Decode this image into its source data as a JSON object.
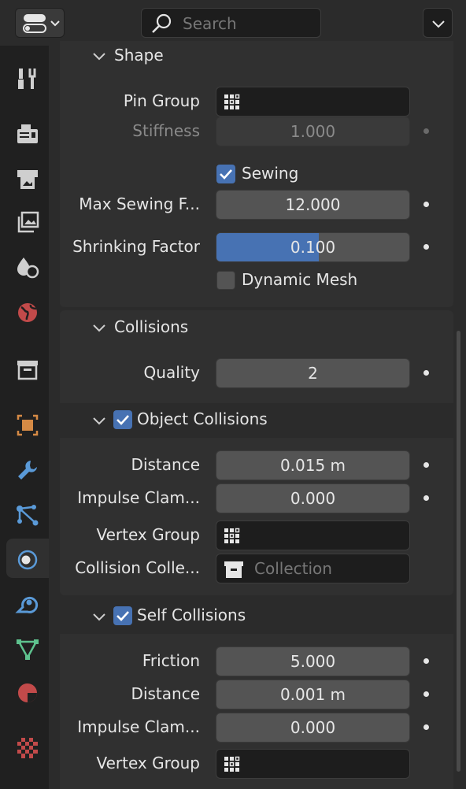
{
  "header": {
    "search_placeholder": "Search"
  },
  "tabs": [
    {
      "name": "tool-tab",
      "icon": "tool-icon"
    },
    {
      "name": "render-tab",
      "icon": "render-icon"
    },
    {
      "name": "output-tab",
      "icon": "output-icon"
    },
    {
      "name": "view-layer-tab",
      "icon": "view-layer-icon"
    },
    {
      "name": "scene-tab",
      "icon": "scene-icon"
    },
    {
      "name": "world-tab",
      "icon": "world-icon"
    },
    {
      "name": "collection-tab",
      "icon": "collection-icon"
    },
    {
      "name": "object-tab",
      "icon": "object-icon"
    },
    {
      "name": "modifiers-tab",
      "icon": "wrench-icon"
    },
    {
      "name": "particles-tab",
      "icon": "particles-icon"
    },
    {
      "name": "physics-tab",
      "icon": "physics-icon",
      "active": true
    },
    {
      "name": "constraints-tab",
      "icon": "constraint-icon"
    },
    {
      "name": "data-tab",
      "icon": "mesh-data-icon"
    },
    {
      "name": "material-tab",
      "icon": "material-icon"
    },
    {
      "name": "texture-tab",
      "icon": "texture-icon"
    }
  ],
  "shape": {
    "title": "Shape",
    "pin_group_label": "Pin Group",
    "pin_group_value": "",
    "stiffness_label": "Stiffness",
    "stiffness_value": "1.000",
    "sewing_label": "Sewing",
    "sewing_checked": true,
    "max_sewing_label": "Max Sewing F...",
    "max_sewing_value": "12.000",
    "shrinking_label": "Shrinking Factor",
    "shrinking_value": "0.100",
    "shrinking_fill_fraction": 0.53,
    "dynamic_mesh_label": "Dynamic Mesh",
    "dynamic_mesh_checked": false
  },
  "collisions": {
    "title": "Collisions",
    "quality_label": "Quality",
    "quality_value": "2",
    "object": {
      "title": "Object Collisions",
      "checked": true,
      "distance_label": "Distance",
      "distance_value": "0.015 m",
      "impulse_label": "Impulse Clam...",
      "impulse_value": "0.000",
      "vertex_group_label": "Vertex Group",
      "vertex_group_value": "",
      "collection_label": "Collision Colle...",
      "collection_placeholder": "Collection"
    },
    "self": {
      "title": "Self Collisions",
      "checked": true,
      "friction_label": "Friction",
      "friction_value": "5.000",
      "distance_label": "Distance",
      "distance_value": "0.001 m",
      "impulse_label": "Impulse Clam...",
      "impulse_value": "0.000",
      "vertex_group_label": "Vertex Group",
      "vertex_group_value": ""
    }
  },
  "colors": {
    "accent": "#4772b3",
    "panel": "#303030",
    "field": "#545454"
  }
}
